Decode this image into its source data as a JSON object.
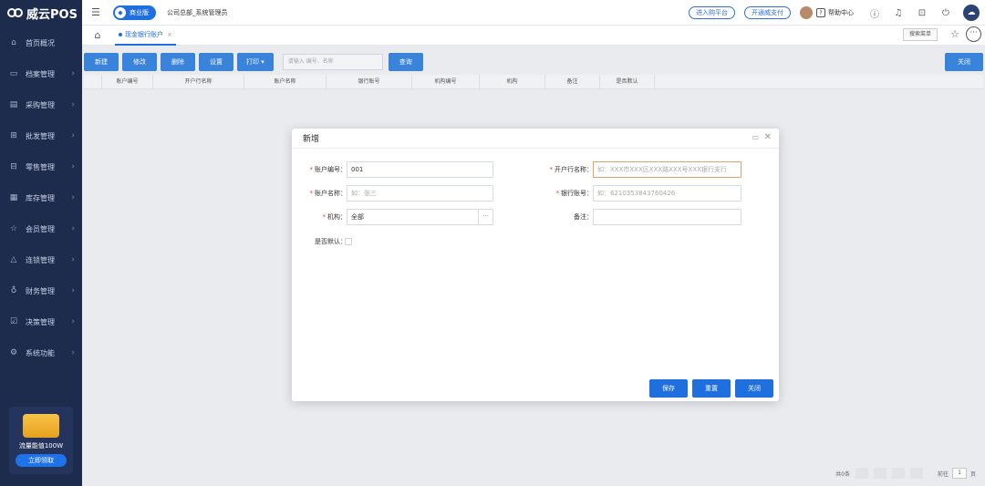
{
  "app": {
    "name": "威云POS"
  },
  "sidebar": {
    "items": [
      {
        "label": "首页概况",
        "icon": "home-icon"
      },
      {
        "label": "档案管理",
        "icon": "folder-icon"
      },
      {
        "label": "采购管理",
        "icon": "cart-icon"
      },
      {
        "label": "批发管理",
        "icon": "wholesale-icon"
      },
      {
        "label": "零售管理",
        "icon": "retail-icon"
      },
      {
        "label": "库存管理",
        "icon": "inventory-icon"
      },
      {
        "label": "会员管理",
        "icon": "member-icon"
      },
      {
        "label": "连锁管理",
        "icon": "chain-icon"
      },
      {
        "label": "财务管理",
        "icon": "finance-icon"
      },
      {
        "label": "决策管理",
        "icon": "decision-icon"
      },
      {
        "label": "系统功能",
        "icon": "system-icon"
      }
    ],
    "promo": {
      "text": "流量能值100W",
      "button": "立即领取"
    }
  },
  "topbar": {
    "edition": "商业版",
    "company": "公司总部_系统管理员",
    "purchase_platform": "进入购平台",
    "open_payment": "开通威支付",
    "help_center": "帮助中心"
  },
  "tabs": {
    "active": "现金银行账户",
    "search_menu": "搜索菜单"
  },
  "toolbar": {
    "new": "新建",
    "edit": "修改",
    "delete": "删除",
    "settings": "设置",
    "print": "打印",
    "search_placeholder": "请输入 编号、名称",
    "query": "查询",
    "close": "关闭"
  },
  "grid": {
    "columns": [
      "账户编号",
      "开户行名称",
      "账户名称",
      "银行账号",
      "机构编号",
      "机构",
      "备注",
      "是否默认"
    ]
  },
  "pager": {
    "total": "共0条",
    "goto": "前往",
    "page": "1",
    "unit": "页"
  },
  "modal": {
    "title": "新增",
    "fields": {
      "account_no_label": "账户编号：",
      "account_no_value": "001",
      "bank_name_label": "开户行名称：",
      "bank_name_placeholder": "如：XXX市XXX区XXX路XXX号XXX银行支行",
      "account_name_label": "账户名称：",
      "account_name_placeholder": "如：张三",
      "bank_account_label": "银行账号：",
      "bank_account_placeholder": "如：6210353843760426",
      "org_label": "机构：",
      "org_value": "全部",
      "remark_label": "备注：",
      "default_label": "是否默认："
    },
    "buttons": {
      "save": "保存",
      "reset": "重置",
      "close": "关闭"
    }
  },
  "colors": {
    "sidebar": "#1d2b4d",
    "primary": "#1f6fde",
    "button": "#3b86e0"
  }
}
